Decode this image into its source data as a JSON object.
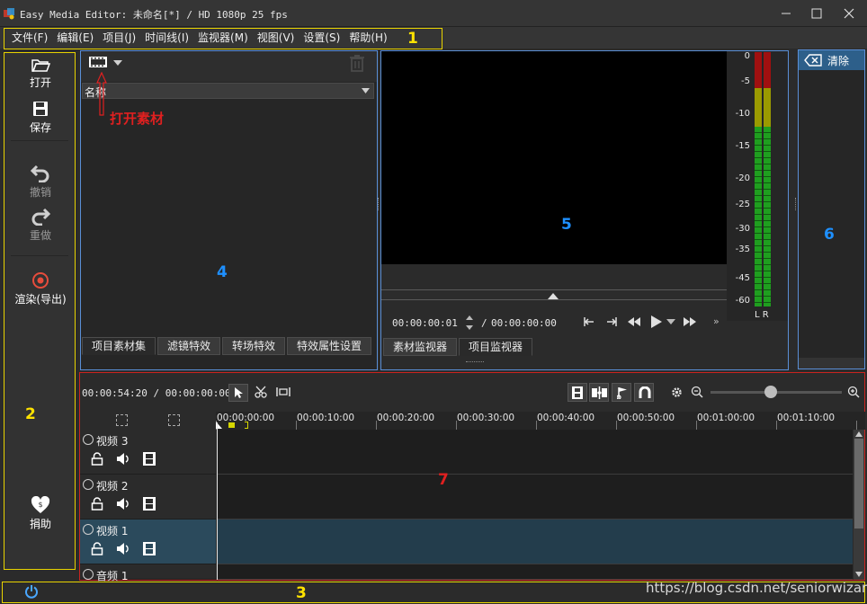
{
  "window": {
    "title": "Easy Media Editor: 未命名[*] / HD 1080p 25 fps"
  },
  "menu": {
    "items": [
      "文件(F)",
      "编辑(E)",
      "项目(J)",
      "时间线(I)",
      "监视器(M)",
      "视图(V)",
      "设置(S)",
      "帮助(H)"
    ]
  },
  "left_toolbar": {
    "open": "打开",
    "save": "保存",
    "undo": "撤销",
    "redo": "重做",
    "render": "渲染(导出)",
    "donate": "捐助"
  },
  "media_bin": {
    "column_header": "名称",
    "tabs": [
      "项目素材集",
      "滤镜特效",
      "转场特效",
      "特效属性设置"
    ]
  },
  "monitor": {
    "current_time": "00:00:00:01",
    "separator": "/",
    "total_time": "00:00:00:00",
    "tabs": [
      "素材监视器",
      "项目监视器"
    ],
    "vu_labels": [
      "0",
      "-5",
      "-10",
      "-15",
      "-20",
      "-25",
      "-30",
      "-35",
      "-45",
      "-60"
    ],
    "channels": "L R"
  },
  "clear_panel": {
    "label": "清除"
  },
  "timeline": {
    "position": "00:00:54:20 / 00:00:00:00",
    "ruler": [
      "00:00:00:00",
      "00:00:10:00",
      "00:00:20:00",
      "00:00:30:00",
      "00:00:40:00",
      "00:00:50:00",
      "00:01:00:00",
      "00:01:10:00"
    ],
    "tracks": [
      {
        "name": "视频 3"
      },
      {
        "name": "视频 2"
      },
      {
        "name": "视频 1"
      },
      {
        "name": "音频 1"
      }
    ]
  },
  "annotations": {
    "n1": "1",
    "n2": "2",
    "n3": "3",
    "n4": "4",
    "n5": "5",
    "n6": "6",
    "n7": "7",
    "open_media": "打开素材"
  },
  "watermark": "https://blog.csdn.net/seniorwizard",
  "colors": {
    "yellow_box": "#e8d300",
    "blue_box": "#5a8fd6",
    "red_box": "#c9231f",
    "accent": "#2d5f8a"
  }
}
